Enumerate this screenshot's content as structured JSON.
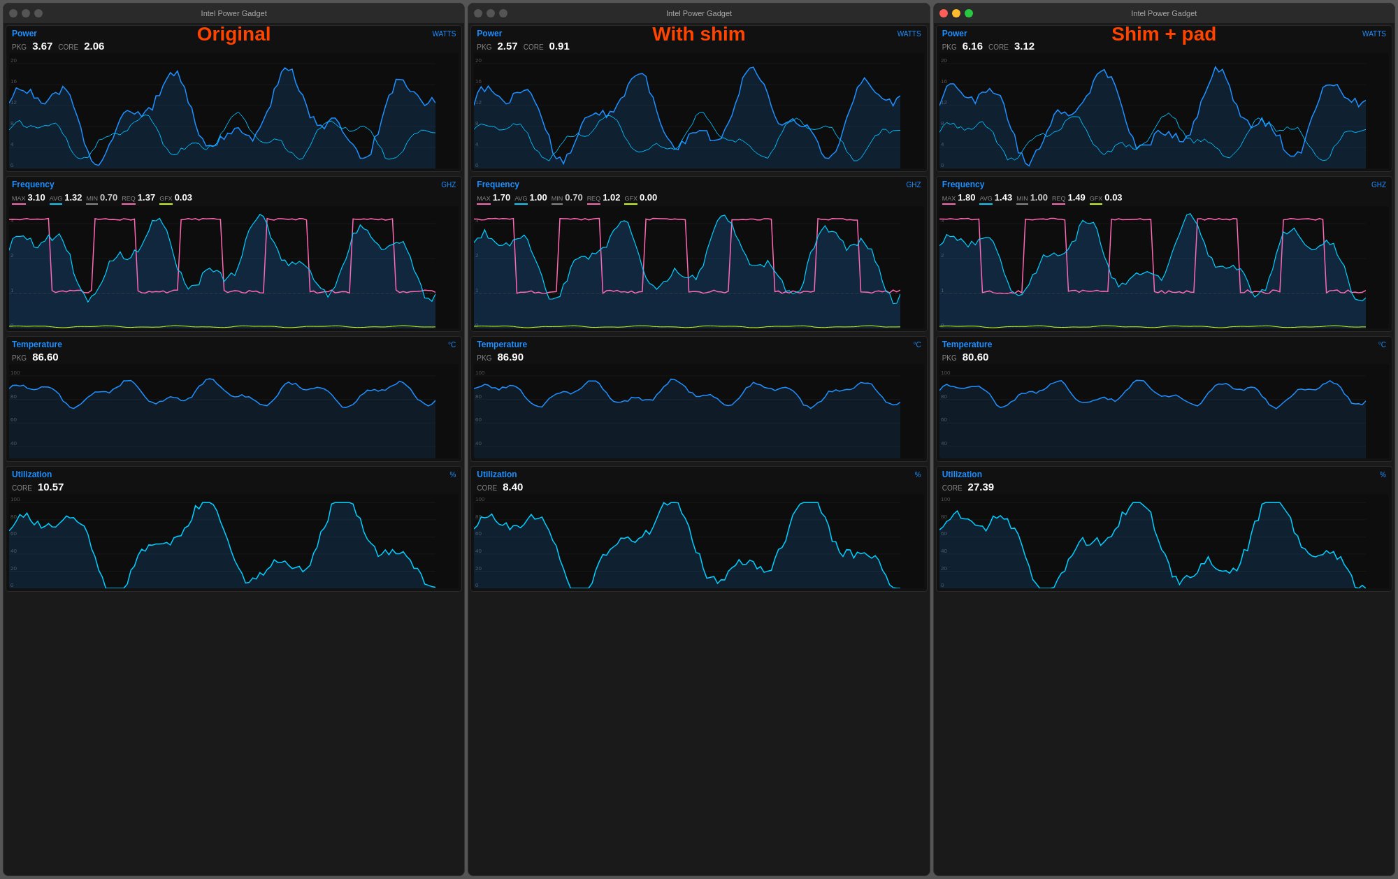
{
  "windows": [
    {
      "id": "original",
      "title": "Intel Power Gadget",
      "overlay": "Original",
      "overlay_color": "#ff4400",
      "traffic_lights": [
        "grey",
        "grey",
        "grey"
      ],
      "power": {
        "pkg": "3.67",
        "core": "2.06"
      },
      "frequency": {
        "max": "3.10",
        "avg": "1.32",
        "min": "0.70",
        "req": "1.37",
        "gfx": "0.03"
      },
      "temperature": {
        "pkg": "86.60"
      },
      "utilization": {
        "core": "10.57"
      }
    },
    {
      "id": "with-shim",
      "title": "Intel Power Gadget",
      "overlay": "With shim",
      "overlay_color": "#ff4400",
      "traffic_lights": [
        "grey",
        "grey",
        "grey"
      ],
      "power": {
        "pkg": "2.57",
        "core": "0.91"
      },
      "frequency": {
        "max": "1.70",
        "avg": "1.00",
        "min": "0.70",
        "req": "1.02",
        "gfx": "0.00"
      },
      "temperature": {
        "pkg": "86.90"
      },
      "utilization": {
        "core": "8.40"
      }
    },
    {
      "id": "shim-pad",
      "title": "Intel Power Gadget",
      "overlay": "Shim + pad",
      "overlay_color": "#ff4400",
      "traffic_lights": [
        "close",
        "min",
        "max"
      ],
      "power": {
        "pkg": "6.16",
        "core": "3.12"
      },
      "frequency": {
        "max": "1.80",
        "avg": "1.43",
        "min": "1.00",
        "req": "1.49",
        "gfx": "0.03"
      },
      "temperature": {
        "pkg": "80.60"
      },
      "utilization": {
        "core": "27.39"
      }
    }
  ],
  "labels": {
    "power": "Power",
    "frequency": "Frequency",
    "temperature": "Temperature",
    "utilization": "Utilization",
    "watts": "WATTS",
    "ghz": "GHZ",
    "celsius": "°C",
    "percent": "%",
    "pkg": "PKG",
    "core": "CORE",
    "max": "MAX",
    "avg": "AVG",
    "min": "MIN",
    "req": "REQ",
    "gfx": "GFX"
  }
}
